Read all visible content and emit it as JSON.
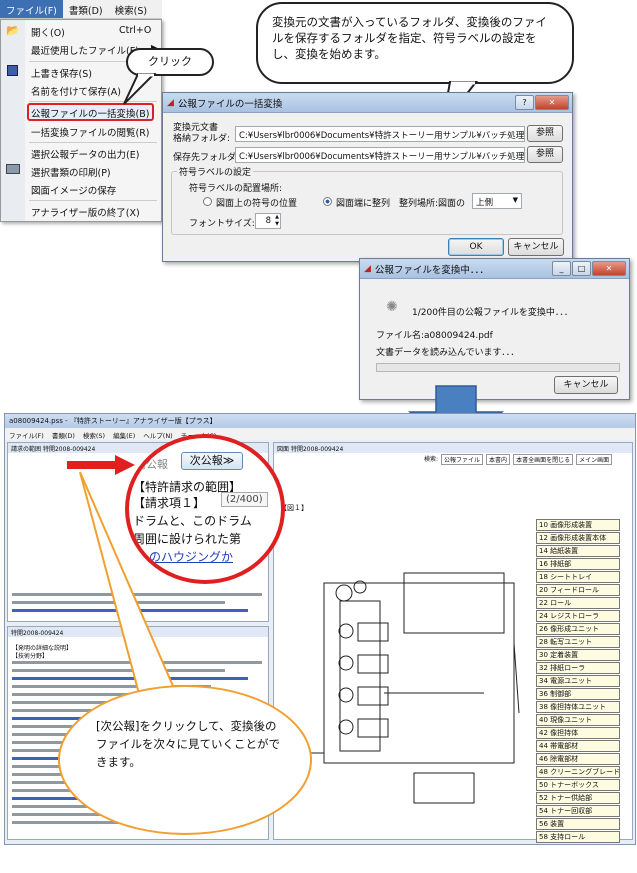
{
  "menubar": {
    "file": "ファイル(F)",
    "view": "書類(D)",
    "search": "検索(S)"
  },
  "menu": {
    "items": [
      "開く(O)",
      "最近使用したファイル(F)",
      "上書き保存(S)",
      "名前を付けて保存(A)",
      "公報ファイルの一括変換(B)",
      "一括変換ファイルの閲覧(R)",
      "選択公報データの出力(E)",
      "選択書類の印刷(P)",
      "図面イメージの保存",
      "アナライザー版の終了(X)"
    ],
    "shortcut_open": "Ctrl+O"
  },
  "callouts": {
    "click": "クリック",
    "top": "変換元の文書が入っているフォルダ、変換後のファイルを保存するフォルダを指定、符号ラベルの設定をし、変換を始めます。",
    "bottom": "[次公報]をクリックして、変換後のファイルを次々に見ていくことができます。"
  },
  "batch_dialog": {
    "title": "公報ファイルの一括変換",
    "src_label1": "変換元文書",
    "src_label2": "格納フォルダ:",
    "src_path": "C:¥Users¥lbr0006¥Documents¥特許ストーリー用サンプル¥バッチ処理",
    "dst_label": "保存先フォルダ:",
    "dst_path": "C:¥Users¥lbr0006¥Documents¥特許ストーリー用サンプル¥バッチ処理結果",
    "browse": "参照",
    "group_label": "符号ラベルの設定",
    "place_label": "符号ラベルの配置場所:",
    "opt1": "図面上の符号の位置",
    "opt2": "図面端に整列",
    "align_label": "整列場所:図面の",
    "align_value": "上側",
    "font_label": "フォントサイズ:",
    "font_value": "8",
    "ok": "OK",
    "cancel": "キャンセル"
  },
  "progress_dialog": {
    "title": "公報ファイルを変換中．．．",
    "count": "1/200件目の公報ファイルを変換中．．．",
    "filename": "ファイル名:a08009424.pdf",
    "status": "文書データを読み込んでいます．．．",
    "cancel": "キャンセル",
    "progress": 0.0
  },
  "screenshot": {
    "title": "a08009424.pss - 『特許ストーリー』アナライザー版【プラス】",
    "menus": [
      "ファイル(F)",
      "書類(D)",
      "検索(S)",
      "編集(E)",
      "ヘルプ(N)",
      "チェック(C)"
    ],
    "left_title": "請求の範囲",
    "left_doc": "特開2008-009424",
    "prev_btn": "前公報",
    "next_btn": "次公報≫",
    "counter": "(2/400)",
    "claim_heading": "【特許請求の範囲】",
    "claim_item": "【請求項１】",
    "claim_text1": "ドラムと、このドラム",
    "claim_text2": "周囲に設けられた第",
    "claim_text3": "のハウジングか",
    "detail_title": "特開2008-009424",
    "detail_heading": "【発明の詳細な説明】",
    "detail_field": "【技術分野】",
    "right_title": "図面",
    "right_doc": "特開2008-009424",
    "fig_label": "【図１】",
    "toolbar": [
      "公報ファイル",
      "本書内",
      "本書全画面を閉じる",
      "メイン画面"
    ],
    "search_label": "検索:",
    "parts": [
      "10 画像形成装置",
      "12 画像形成装置本体",
      "14 給紙装置",
      "16 排紙部",
      "18 シートトレイ",
      "20 フィードロール",
      "22 ロール",
      "24 レジストローラ",
      "26 像形成ユニット",
      "28 転写ユニット",
      "30 定着装置",
      "32 排紙ローラ",
      "34 電源ユニット",
      "36 制御部",
      "38 像担持体ユニット",
      "40 現像ユニット",
      "42 像担持体",
      "44 帯電部材",
      "46 除電部材",
      "48 クリーニングブレード",
      "50 トナーボックス",
      "52 トナー供給部",
      "54 トナー回収部",
      "56 装置",
      "58 支持ロール"
    ]
  },
  "colors": {
    "accent_red": "#e02020",
    "arrow_blue": "#4a7fc0",
    "callout_orange": "#f0a030"
  }
}
